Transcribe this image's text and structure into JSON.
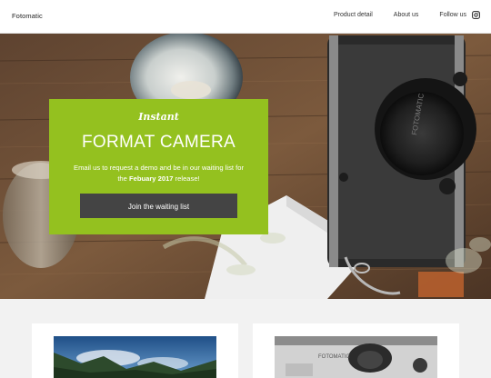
{
  "header": {
    "brand": "Fotomatic",
    "nav": {
      "product": "Product detail",
      "about": "About us",
      "follow": "Follow us"
    },
    "social_icon": "instagram-icon"
  },
  "hero": {
    "camera_label": "FOTOMATIC",
    "promo": {
      "eyebrow": "Instant",
      "title": "FORMAT CAMERA",
      "text_before": "Email us to request a demo and be in our waiting list for the ",
      "text_bold": "Febuary 2017",
      "text_after": " release!",
      "button": "Join the waiting list",
      "background": "#94c11f"
    }
  },
  "cards": {
    "right_camera_label": "FOTOMATIC"
  }
}
